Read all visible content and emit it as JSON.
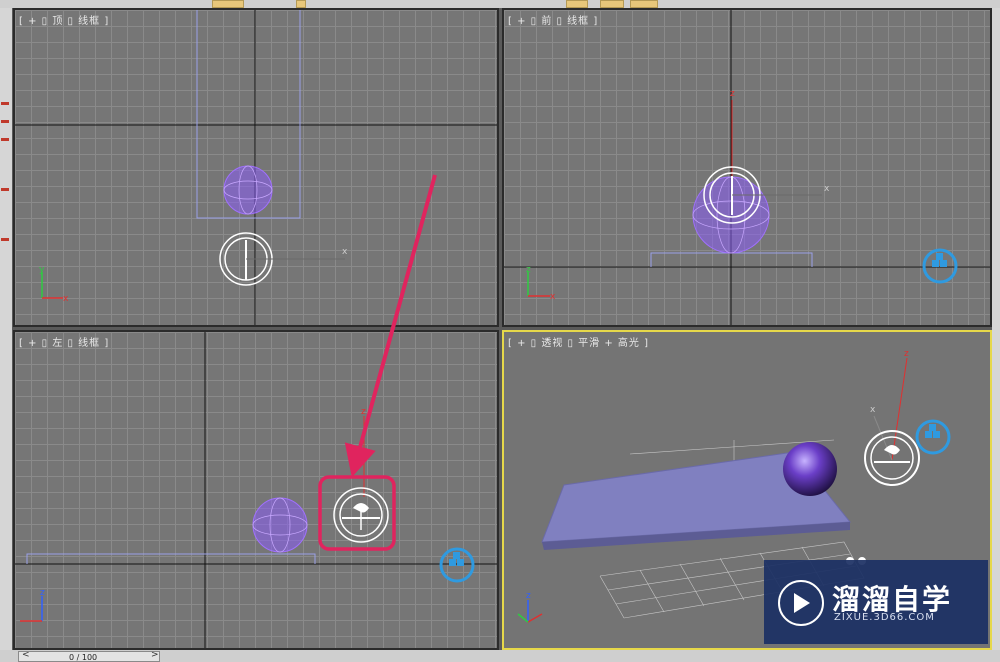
{
  "viewports": {
    "top": {
      "label": "[ + ▯ 顶 ▯ 线框 ]"
    },
    "front": {
      "label": "[ + ▯ 前 ▯ 线框 ]"
    },
    "left": {
      "label": "[ + ▯ 左 ▯ 线框 ]"
    },
    "perspective": {
      "label": "[ + ▯ 透视 ▯ 平滑 + 高光 ]"
    }
  },
  "axis_labels": {
    "x": "x",
    "y": "y",
    "z": "z"
  },
  "timeline": {
    "counter": "0 / 100",
    "prev": "<",
    "next": ">"
  },
  "watermark": {
    "brand": "溜溜自学",
    "url": "ZIXUE.3D66.COM"
  },
  "colors": {
    "active_viewport_border": "#e6d84a",
    "sphere_wire": "#8b5cf6",
    "plane": "#8080c0",
    "annotation": "#e0245e",
    "gizmo": "#ffffff",
    "nav_cube": "#2f9ae0"
  },
  "icons": [
    "sun-compass-icon",
    "viewcube-icon",
    "play-logo-icon"
  ]
}
